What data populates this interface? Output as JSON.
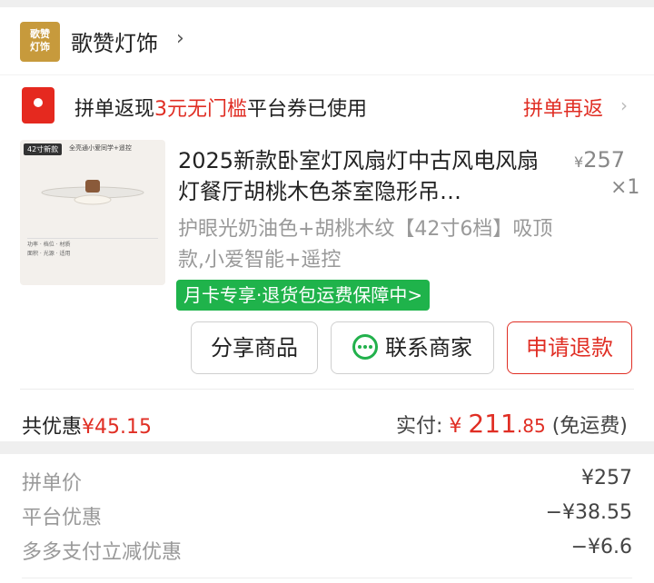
{
  "shop": {
    "logo_text": "歌赞灯饰",
    "name": "歌赞灯饰",
    "chevron": "chevron-right-icon"
  },
  "group_buy": {
    "prefix": "拼单返现",
    "highlight": "3元无门槛",
    "suffix": "平台券已使用",
    "again_label": "拼单再返"
  },
  "product": {
    "image_badge": "42寸新款",
    "image_title": "全亮通小爱同学+遥控",
    "title": "2025新款卧室灯风扇灯中古风电风扇灯餐厅胡桃木色茶室隐形吊…",
    "price": "257",
    "currency": "¥",
    "quantity": "×1",
    "spec": "护眼光奶油色+胡桃木纹【42寸6档】吸顶款,小爱智能+遥控",
    "promo_tag": "月卡专享·退货包运费保障中>"
  },
  "actions": {
    "share": "分享商品",
    "contact": "联系商家",
    "refund": "申请退款"
  },
  "summary": {
    "discount_label": "共优惠",
    "discount_value": "¥45.15",
    "paid_label": "实付:",
    "paid_currency": "¥",
    "paid_int": "211",
    "paid_dec": ".85",
    "shipping": "(免运费)"
  },
  "breakdown": [
    {
      "label": "拼单价",
      "value": "¥257"
    },
    {
      "label": "平台优惠",
      "value": "−¥38.55"
    },
    {
      "label": "多多支付立减优惠",
      "value": "−¥6.6"
    }
  ],
  "colors": {
    "accent_red": "#e02e24",
    "promo_green": "#1fb34b",
    "shop_logo": "#c79a3c"
  }
}
